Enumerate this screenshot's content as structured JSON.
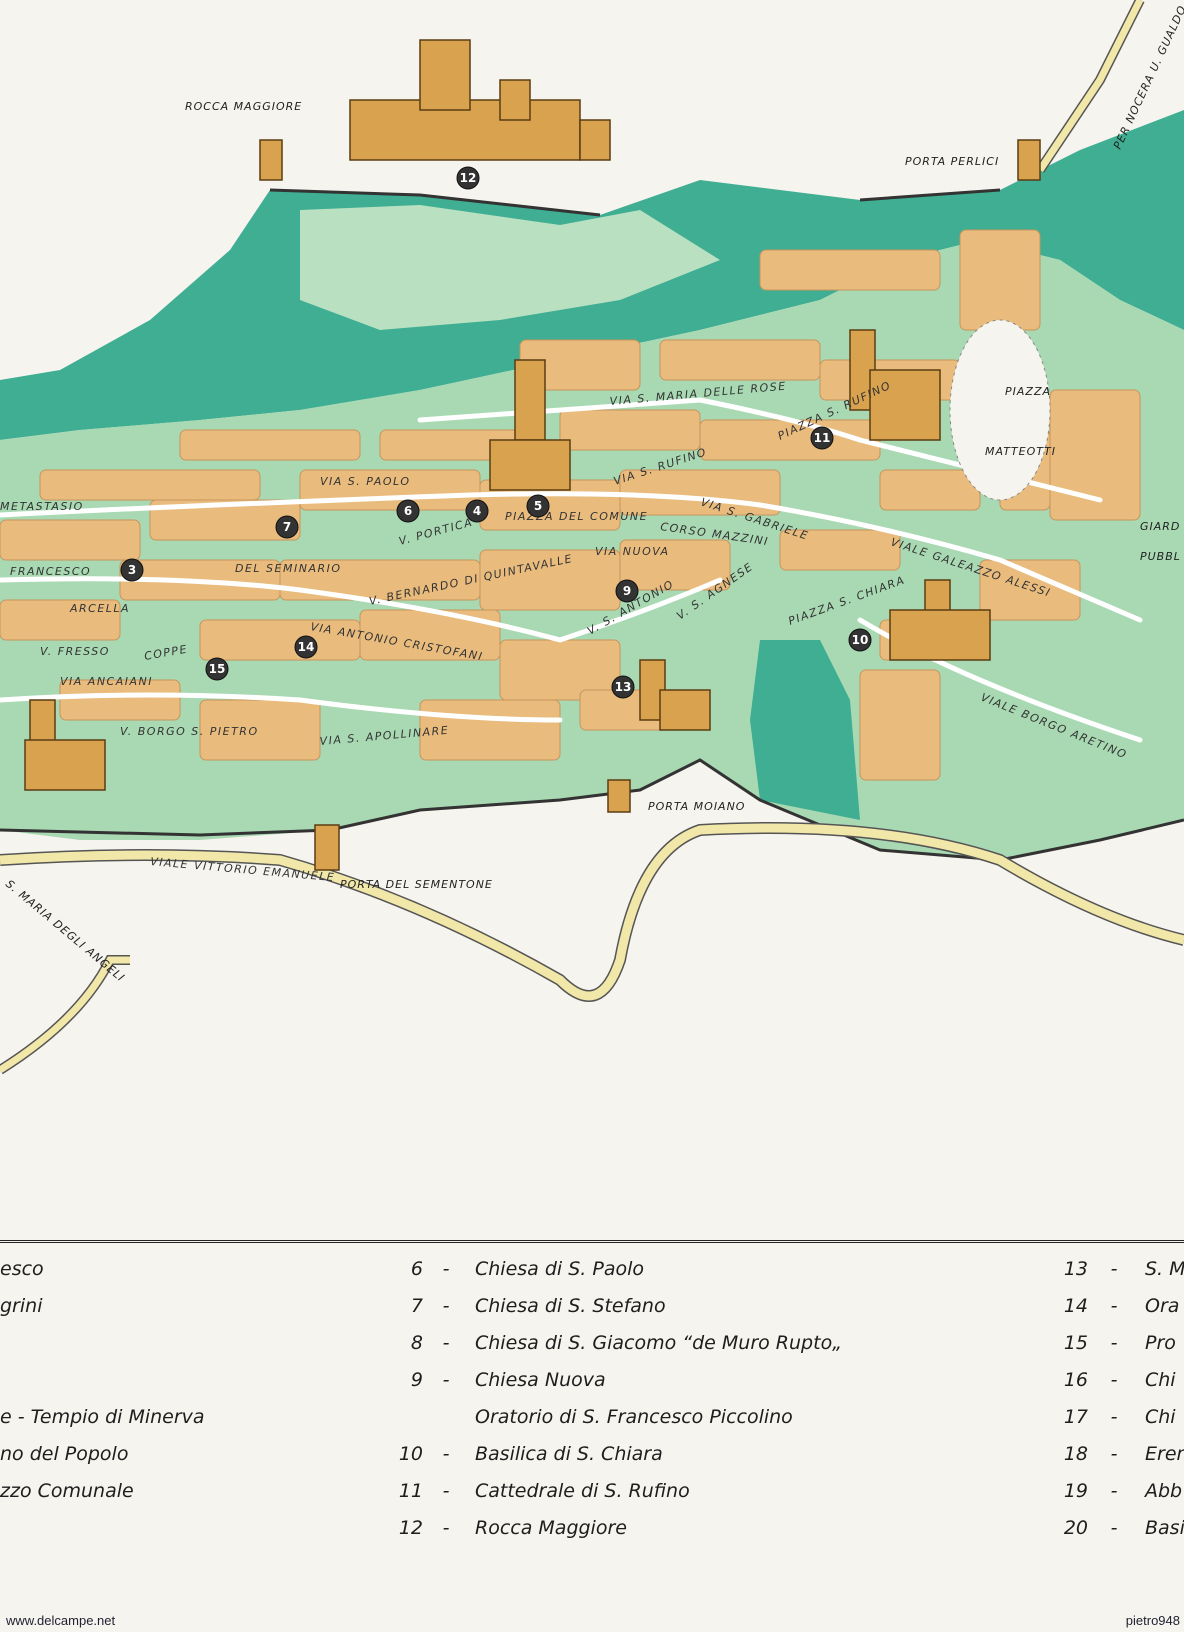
{
  "map": {
    "place_labels": {
      "rocca": "ROCCA MAGGIORE",
      "porta_perlici": "PORTA PERLICI",
      "per_nocera": "PER NOCERA U. GUALDO",
      "piazza_matteotti_1": "PIAZZA",
      "piazza_matteotti_2": "MATTEOTTI",
      "porta_moiano": "PORTA MOIANO",
      "porta_sementone": "PORTA DEL SEMENTONE",
      "santa_maria_angeli": "S. MARIA DEGLI ANGELI",
      "giardino": "GIARD",
      "pubblico": "PUBBL"
    },
    "streets": {
      "s_paolo": "VIA S. PAOLO",
      "metastasio": "METASTASIO",
      "francesco": "FRANCESCO",
      "arcella": "ARCELLA",
      "seminario": "DEL SEMINARIO",
      "portica": "V. PORTICA",
      "piazza_comune": "PIAZZA DEL COMUNE",
      "corso_mazzini": "CORSO MAZZINI",
      "s_rufino": "VIA S. RUFINO",
      "s_gabriele": "VIA S. GABRIELE",
      "viale_galeazzo": "VIALE GALEAZZO ALESSI",
      "antonio_cristofani": "VIA ANTONIO CRISTOFANI",
      "v_bernardo": "V. BERNARDO DI QUINTAVALLE",
      "s_maria_rose": "VIA S. MARIA DELLE ROSE",
      "piazza_s_rufino": "PIAZZA S. RUFINO",
      "s_agnese": "V. S. AGNESE",
      "s_antonio": "V. S. ANTONIO",
      "piazza_s_chiara": "PIAZZA S. CHIARA",
      "borgo_aretino": "VIALE BORGO ARETINO",
      "anciaiani": "VIA ANCAIANI",
      "borgo_s_pietro": "V. BORGO S. PIETRO",
      "s_apollinare": "VIA S. APOLLINARE",
      "viale_vittorio": "VIALE VITTORIO EMANUELE",
      "v_fuori": "V. FRESSO",
      "v_coppe": "COPPE",
      "via_nuova": "VIA NUOVA"
    },
    "markers": [
      "12",
      "11",
      "6",
      "4",
      "5",
      "7",
      "3",
      "9",
      "10",
      "14",
      "15",
      "13"
    ],
    "colors": {
      "hill_teal": "#3fae93",
      "light_green": "#a8d9b3",
      "buildings": "#e9bc7e",
      "background": "#f6f4ee",
      "road": "#f1e7a8"
    }
  },
  "legend": {
    "col1": [
      {
        "num": "",
        "label": "esco"
      },
      {
        "num": "",
        "label": "grini"
      },
      {
        "num": "",
        "label": ""
      },
      {
        "num": "",
        "label": ""
      },
      {
        "num": "",
        "label": "e - Tempio di Minerva"
      },
      {
        "num": "",
        "label": "no del Popolo"
      },
      {
        "num": "",
        "label": "zzo Comunale"
      },
      {
        "num": "",
        "label": ""
      }
    ],
    "col2": [
      {
        "num": "6",
        "label": "Chiesa di S. Paolo"
      },
      {
        "num": "7",
        "label": "Chiesa di S. Stefano"
      },
      {
        "num": "8",
        "label": "Chiesa di S. Giacomo “de Muro Rupto„"
      },
      {
        "num": "9",
        "label": "Chiesa Nuova"
      },
      {
        "num": "",
        "label": "Oratorio di S. Francesco Piccolino"
      },
      {
        "num": "10",
        "label": "Basilica di S. Chiara"
      },
      {
        "num": "11",
        "label": "Cattedrale di S. Rufino"
      },
      {
        "num": "12",
        "label": "Rocca Maggiore"
      }
    ],
    "col3": [
      {
        "num": "13",
        "label": "S. M"
      },
      {
        "num": "14",
        "label": "Ora"
      },
      {
        "num": "15",
        "label": "Pro"
      },
      {
        "num": "16",
        "label": "Chi"
      },
      {
        "num": "17",
        "label": "Chi"
      },
      {
        "num": "18",
        "label": "Erem"
      },
      {
        "num": "19",
        "label": "Abb"
      },
      {
        "num": "20",
        "label": "Basi"
      }
    ]
  },
  "footer": {
    "left": "www.delcampe.net",
    "right": "pietro948"
  }
}
